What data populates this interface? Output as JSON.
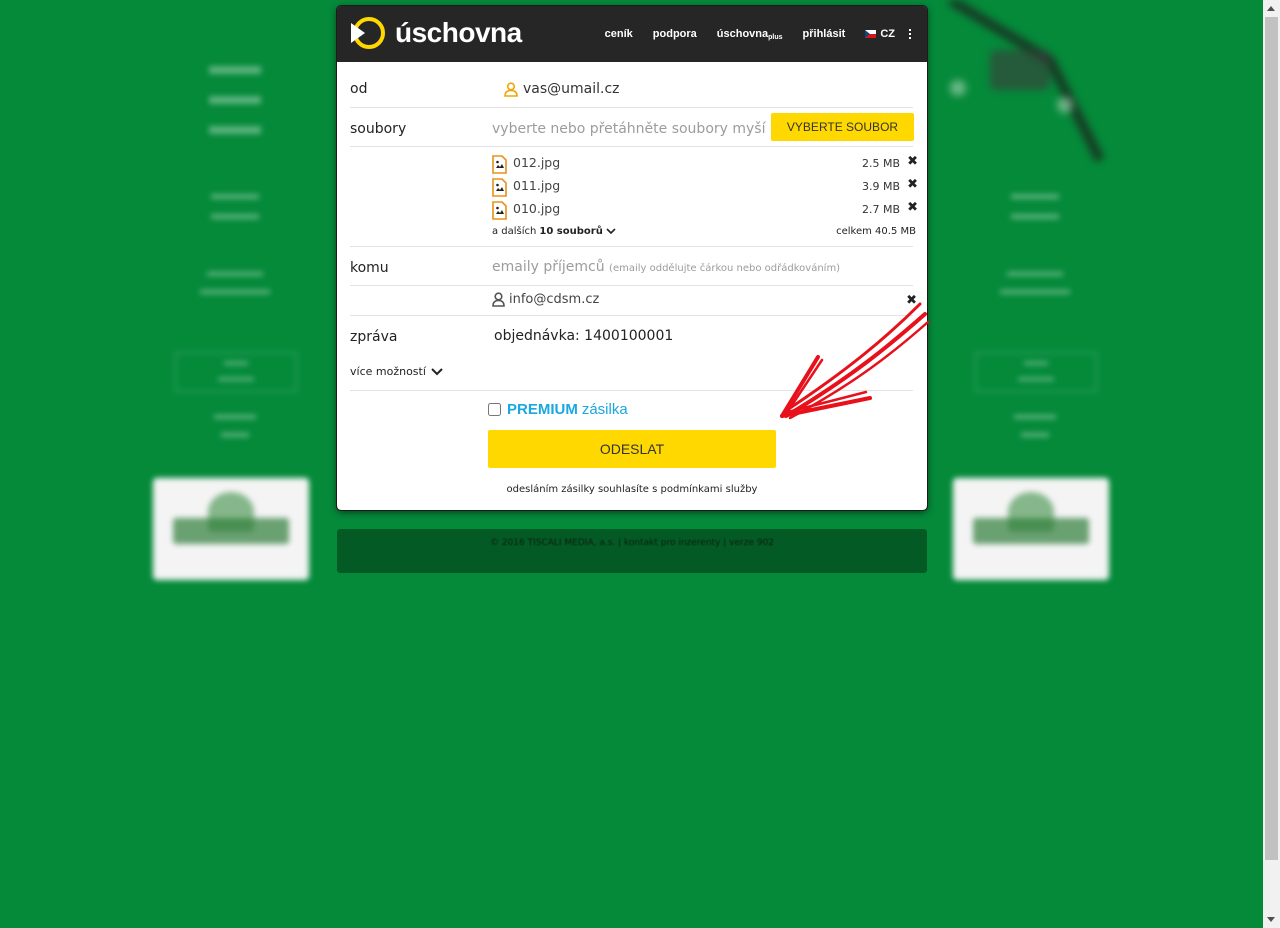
{
  "header": {
    "logo_text": "úschovna",
    "nav": {
      "pricing": "ceník",
      "support": "podpora",
      "plus_main": "úschovna",
      "plus_sub": "plus",
      "login": "přihlásit",
      "lang": "CZ"
    }
  },
  "form": {
    "from_label": "od",
    "from_value": "vas@umail.cz",
    "files_label": "soubory",
    "drop_hint": "vyberte nebo přetáhněte soubory myší",
    "choose_button": "VYBERTE SOUBOR",
    "files": [
      {
        "name": "012.jpg",
        "size": "2.5 MB"
      },
      {
        "name": "011.jpg",
        "size": "3.9 MB"
      },
      {
        "name": "010.jpg",
        "size": "2.7 MB"
      }
    ],
    "more_prefix": "a dalších",
    "more_count": "10 souborů",
    "total": "celkem 40.5 MB",
    "to_label": "komu",
    "to_placeholder": "emaily příjemců",
    "to_hint": "(emaily oddělujte čárkou nebo odřádkováním)",
    "recipient": "info@cdsm.cz",
    "message_label": "zpráva",
    "message_value": "objednávka: 1400100001",
    "more_options": "více možností",
    "premium_bold": "PREMIUM",
    "premium_rest": "zásilka",
    "send_button": "ODESLAT",
    "terms": "odesláním zásilky souhlasíte s podmínkami služby"
  },
  "footer": {
    "text": "© 2016 TISCALI MEDIA, a.s. | kontakt pro inzerenty | verze 902"
  },
  "colors": {
    "background": "#058a3a",
    "accent_yellow": "#ffd800",
    "premium_blue": "#1aa8e0",
    "header_dark": "#262626",
    "annotation_red": "#e8101a"
  }
}
